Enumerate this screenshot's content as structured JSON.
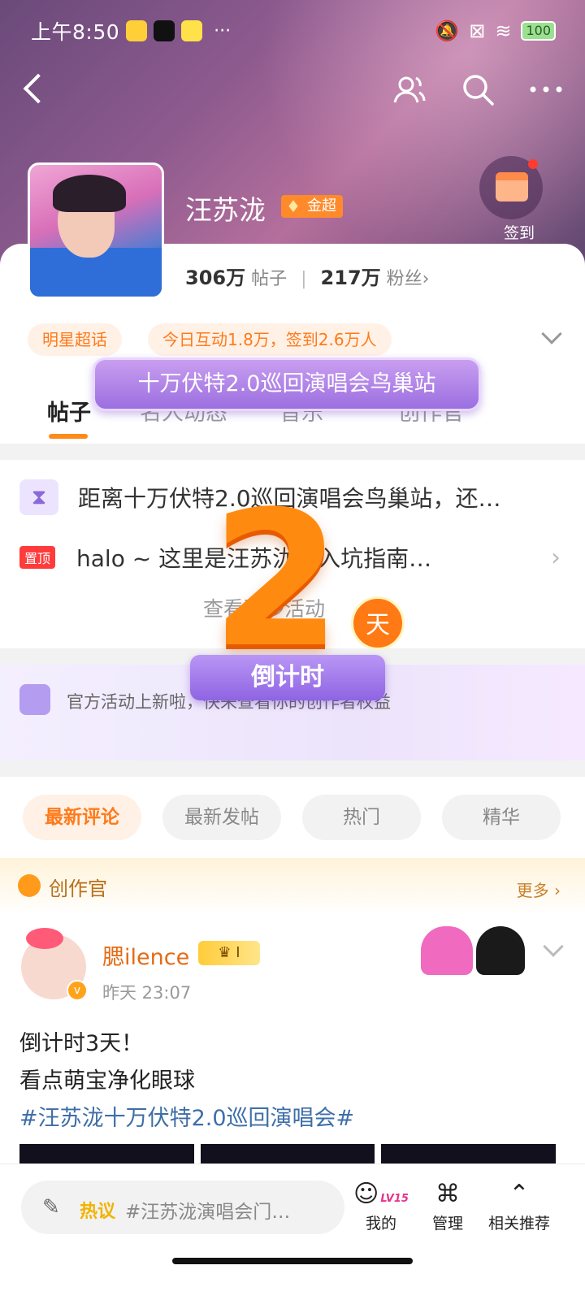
{
  "status": {
    "time": "上午8:50",
    "battery": "100"
  },
  "header": {
    "name": "汪苏泷",
    "badge": "金超",
    "signin": "签到",
    "posts_num": "306万",
    "posts_label": "帖子",
    "fans_num": "217万",
    "fans_label": "粉丝",
    "tags": [
      "明星超话",
      "今日互动1.8万，签到2.6万人"
    ],
    "concert": "十万伏特2.0巡回演唱会鸟巢站"
  },
  "tabs": [
    "帖子",
    "名人动态",
    "音乐",
    "创作官"
  ],
  "pinned": {
    "countdown_text": "距离十万伏特2.0巡回演唱会鸟巢站，还…",
    "pin_tag": "置顶",
    "pin_text": "halo ~ 这里是汪苏泷包入坑指南…",
    "see_more": "查看更多活动"
  },
  "countdown": {
    "number": "2",
    "unit": "天",
    "ribbon": "倒计时"
  },
  "banner": {
    "text": "官方活动上新啦，快来查看你的创作者权益"
  },
  "filters": [
    "最新评论",
    "最新发帖",
    "热门",
    "精华"
  ],
  "creator_section": {
    "label": "创作官",
    "more": "更多"
  },
  "post": {
    "user": "腮ilence",
    "level_badge": "I",
    "time": "昨天 23:07",
    "line1": "倒计时3天！",
    "line2": "看点萌宝净化眼球",
    "hashtag": "#汪苏泷十万伏特2.0巡回演唱会#"
  },
  "bottom": {
    "hot_label": "热议",
    "hot_query": "#汪苏泷演唱会门…",
    "level": "LV15",
    "nav": [
      "我的",
      "管理",
      "相关推荐"
    ]
  }
}
